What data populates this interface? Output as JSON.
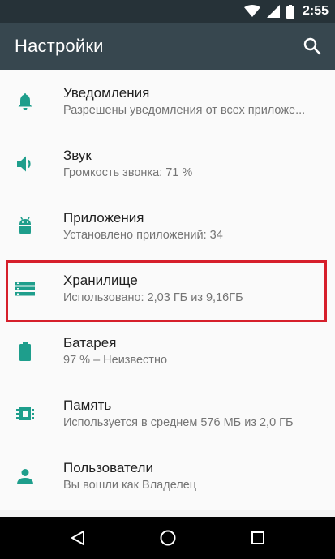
{
  "status_bar": {
    "time": "2:55"
  },
  "app_bar": {
    "title": "Настройки"
  },
  "settings": [
    {
      "title": "Уведомления",
      "subtitle": "Разрешены уведомления от всех приложе...",
      "icon": "bell-icon"
    },
    {
      "title": "Звук",
      "subtitle": "Громкость звонка: 71 %",
      "icon": "volume-icon"
    },
    {
      "title": "Приложения",
      "subtitle": "Установлено приложений: 34",
      "icon": "android-icon"
    },
    {
      "title": "Хранилище",
      "subtitle": "Использовано:  2,03  ГБ из  9,16ГБ",
      "icon": "storage-icon"
    },
    {
      "title": "Батарея",
      "subtitle": "97 % – Неизвестно",
      "icon": "battery-icon"
    },
    {
      "title": "Память",
      "subtitle": "Используется в среднем 576 МБ из 2,0 ГБ",
      "icon": "memory-icon"
    },
    {
      "title": "Пользователи",
      "subtitle": "Вы вошли как Владелец",
      "icon": "user-icon"
    }
  ],
  "colors": {
    "accent": "#1e9e8c",
    "app_bar": "#37474f",
    "status_bar": "#263238",
    "highlight": "#d61f2b"
  }
}
